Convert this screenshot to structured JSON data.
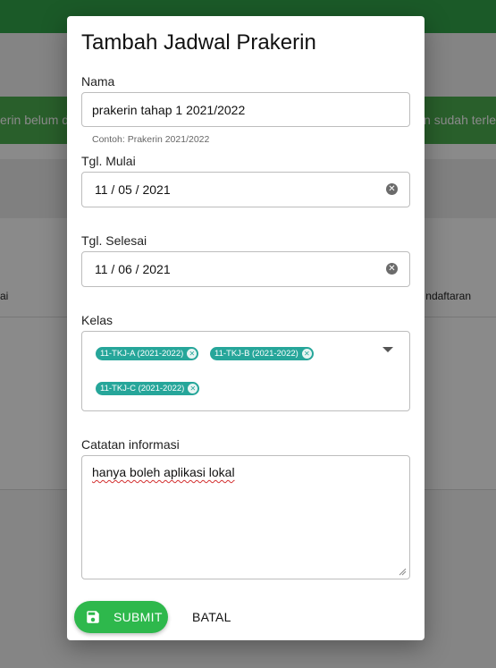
{
  "background": {
    "banner_left_text": "erin belum d",
    "banner_right_text": "n sudah terle",
    "table_left_fragment": "ai",
    "table_right_fragment": "ndaftaran",
    "colors": {
      "topbar": "#33a74a",
      "banner": "#4caf50"
    }
  },
  "dialog": {
    "title": "Tambah Jadwal Prakerin",
    "nama": {
      "label": "Nama",
      "value": "prakerin tahap 1 2021/2022",
      "helper": "Contoh: Prakerin 2021/2022"
    },
    "tgl_mulai": {
      "label": "Tgl. Mulai",
      "day": "11",
      "month": "05",
      "year": "2021",
      "clear_icon": "clear-circle-icon"
    },
    "tgl_selesai": {
      "label": "Tgl. Selesai",
      "day": "11",
      "month": "06",
      "year": "2021",
      "clear_icon": "clear-circle-icon"
    },
    "kelas": {
      "label": "Kelas",
      "chips": [
        "11-TKJ-A (2021-2022)",
        "11-TKJ-B (2021-2022)",
        "11-TKJ-C (2021-2022)"
      ],
      "dropdown_icon": "caret-down-icon"
    },
    "catatan": {
      "label": "Catatan informasi",
      "value": "hanya boleh aplikasi lokal"
    },
    "actions": {
      "submit_label": "SUBMIT",
      "submit_icon": "floppy-disk-icon",
      "cancel_label": "BATAL"
    },
    "colors": {
      "submit": "#2eb84c",
      "chip": "#26a69a"
    }
  }
}
